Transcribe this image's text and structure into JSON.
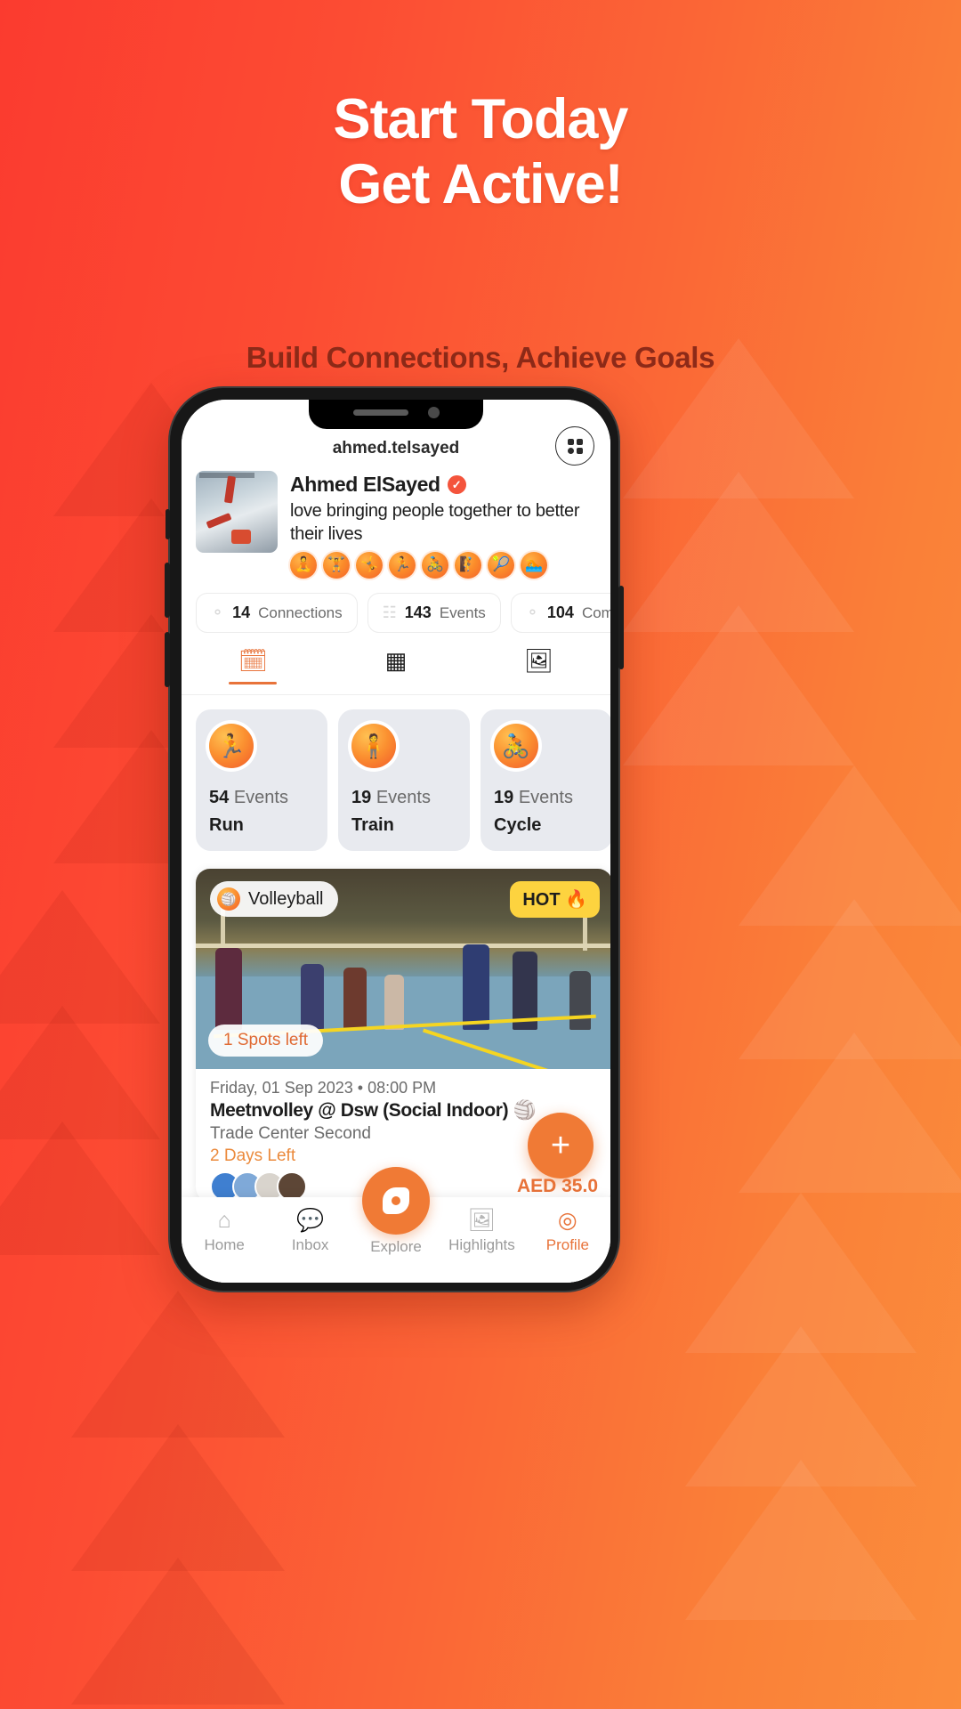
{
  "promo": {
    "headline_line1": "Start Today",
    "headline_line2": "Get Active!",
    "subhead": "Build Connections, Achieve Goals",
    "accent": "#f07a35",
    "bg_start": "#fb3b2f",
    "bg_end": "#fb8d3c",
    "subhead_color": "#8d2a18"
  },
  "app": {
    "handle": "ahmed.telsayed",
    "grid_button": "grid-menu",
    "profile": {
      "name": "Ahmed ElSayed",
      "verified_mark": "✓",
      "bio": "love bringing people together to better their lives",
      "badges": [
        "🧘",
        "🏋",
        "🤸",
        "🏃",
        "🚴",
        "🧗",
        "🎾",
        "🏊"
      ]
    },
    "stats": [
      {
        "icon": "⚬",
        "value": "14",
        "label": "Connections"
      },
      {
        "icon": "☷",
        "value": "143",
        "label": "Events"
      },
      {
        "icon": "⚬",
        "value": "104",
        "label": "Communities"
      }
    ],
    "tabs": [
      {
        "name": "events-tab",
        "icon": "🗓",
        "active": true
      },
      {
        "name": "grid-tab",
        "icon": "▦",
        "active": false
      },
      {
        "name": "media-tab",
        "icon": "🖼",
        "active": false
      }
    ],
    "categories": [
      {
        "icon": "🏃",
        "count": "54",
        "count_label": "Events",
        "name": "Run"
      },
      {
        "icon": "🧍",
        "count": "19",
        "count_label": "Events",
        "name": "Train"
      },
      {
        "icon": "🚴",
        "count": "19",
        "count_label": "Events",
        "name": "Cycle"
      }
    ],
    "event": {
      "sport_chip": "Volleyball",
      "sport_chip_icon": "🏐",
      "hot_badge": "HOT 🔥",
      "spots_badge": "1 Spots left",
      "date": "Friday, 01 Sep 2023 • 08:00 PM",
      "title": "Meetnvolley @ Dsw (Social Indoor) 🏐",
      "location": "Trade Center Second",
      "days_left": "2 Days Left",
      "price": "AED 35.0"
    },
    "fab_label": "+",
    "nav": [
      {
        "name": "nav-home",
        "icon": "⌂",
        "label": "Home",
        "active": false
      },
      {
        "name": "nav-inbox",
        "icon": "💬",
        "label": "Inbox",
        "active": false
      },
      {
        "name": "nav-explore",
        "icon": "explore",
        "label": "Explore",
        "active": false
      },
      {
        "name": "nav-highlights",
        "icon": "🖼",
        "label": "Highlights",
        "active": false
      },
      {
        "name": "nav-profile",
        "icon": "◎",
        "label": "Profile",
        "active": true
      }
    ]
  }
}
